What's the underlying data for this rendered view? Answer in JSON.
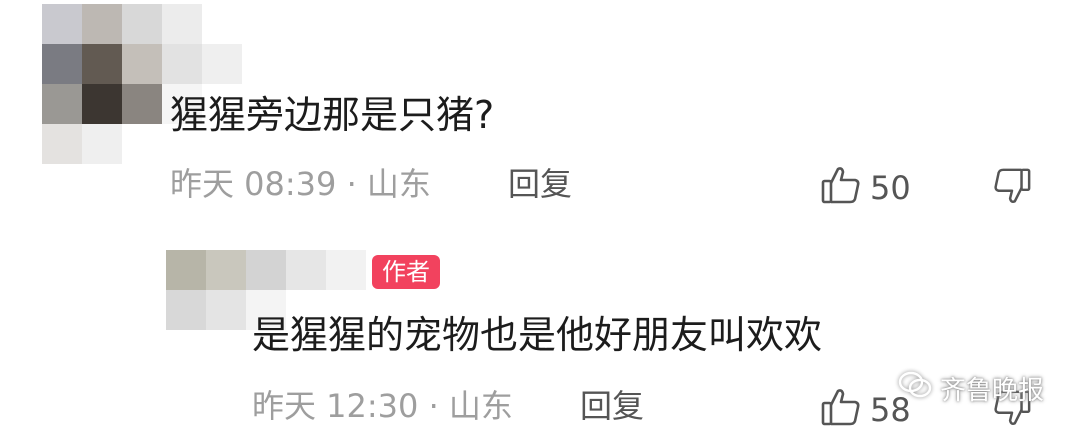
{
  "comments": [
    {
      "text": "猩猩旁边那是只猪?",
      "meta": "昨天 08:39 · 山东",
      "reply_label": "回复",
      "like_count": "50"
    },
    {
      "author_badge": "作者",
      "text": "是猩猩的宠物也是他好朋友叫欢欢",
      "meta": "昨天 12:30 · 山东",
      "reply_label": "回复",
      "like_count": "58"
    }
  ],
  "watermark": {
    "label": "齐鲁晚报",
    "icon": "wechat-icon"
  },
  "colors": {
    "badge": "#f2425e",
    "meta": "#9e9e9e",
    "text": "#1c1c1c"
  }
}
